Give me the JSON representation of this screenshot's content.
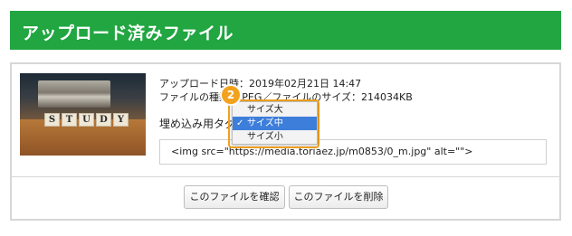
{
  "header": {
    "title": "アップロード済みファイル"
  },
  "file_info": {
    "upload_date": "アップロード日時：2019年02月21日 14:47",
    "file_type_size": "ファイルの種類：JPEG／ファイルのサイズ：214034KB"
  },
  "thumbnail": {
    "letters": [
      "S",
      "T",
      "U",
      "D",
      "Y"
    ]
  },
  "embed": {
    "label": "埋め込み用タグ：",
    "code": "<img src=\"https://media.toriaez.jp/m0853/0_m.jpg\" alt=\"\">"
  },
  "dropdown": {
    "options": [
      "サイズ大",
      "サイズ中",
      "サイズ小"
    ],
    "selected_index": 1,
    "check_mark": "✓"
  },
  "callout": {
    "number": "2",
    "accent_color": "#f2a21d"
  },
  "buttons": {
    "confirm_label": "このファイルを確認",
    "delete_label": "このファイルを削除"
  },
  "colors": {
    "header_bg": "#21a641",
    "highlight": "#3d7edb"
  }
}
